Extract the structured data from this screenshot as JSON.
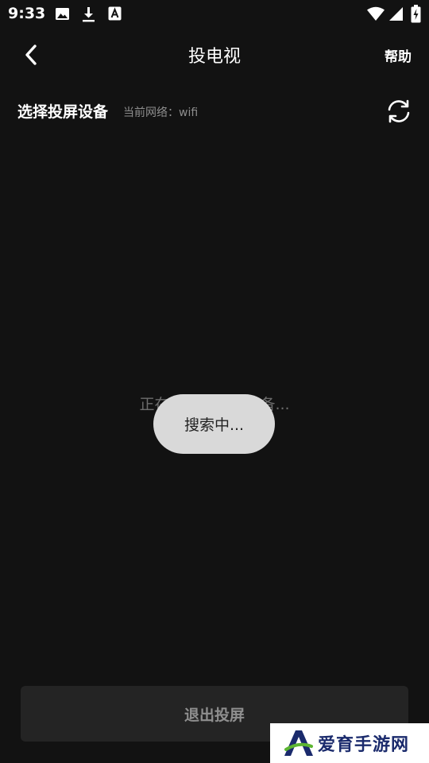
{
  "status_bar": {
    "time": "9:33",
    "icons": [
      "image-icon",
      "download-icon",
      "a-badge-icon",
      "wifi-icon",
      "signal-icon",
      "battery-icon"
    ]
  },
  "header": {
    "title": "投电视",
    "help_label": "帮助"
  },
  "section": {
    "title": "选择投屏设备",
    "network_label": "当前网络：wifi"
  },
  "main": {
    "searching_text": "正在搜索可连接设备..."
  },
  "toast": {
    "text": "搜索中..."
  },
  "footer": {
    "exit_label": "退出投屏"
  },
  "watermark": {
    "text": "爱育手游网"
  },
  "colors": {
    "background": "#121212",
    "toast_bg": "#d9d9d9",
    "button_bg": "#242424",
    "muted_text": "#8e8e8e"
  }
}
